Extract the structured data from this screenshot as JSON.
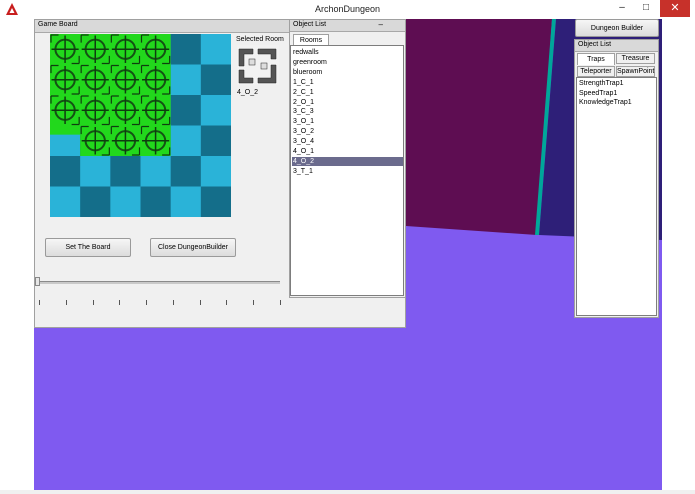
{
  "window": {
    "title": "ArchonDungeon",
    "controls": {
      "minimize": "–",
      "maximize": "□",
      "close": "✕"
    }
  },
  "colors": {
    "viewport_floor": "#7f5af0",
    "wall_dark_purple": "#5e0d52",
    "wall_navy": "#2e1f78",
    "wall_edge_teal": "#00a79a",
    "board_teal_light": "#2ab3d8",
    "board_teal_dark": "#146e8a",
    "room_green": "#22d81c",
    "selected_row": "#6b6b8d"
  },
  "game_board": {
    "title": "Game Board",
    "selected_room_label": "Selected Room",
    "selected_room_name": "4_O_2",
    "set_board_button": "Set The Board",
    "close_builder_button": "Close DungeonBuilder",
    "slider_value": 0,
    "tick_count": 10,
    "grid_rows": 6,
    "grid_cols": 6,
    "placed_room_blocks": 3
  },
  "object_list": {
    "title": "Object List",
    "collapse_glyph": "–",
    "tab": "Rooms",
    "items": [
      "redwalls",
      "greenroom",
      "blueroom",
      "1_C_1",
      "2_C_1",
      "2_O_1",
      "3_C_3",
      "3_O_1",
      "3_O_2",
      "3_O_4",
      "4_O_1",
      "4_O_2",
      "3_T_1"
    ],
    "selected": "4_O_2"
  },
  "dungeon_builder": {
    "button": "Dungeon Builder",
    "object_list_title": "Object List",
    "tabs_row1": [
      "Traps",
      "Treasure"
    ],
    "tabs_row2": [
      "Teleporter",
      "SpawnPoint"
    ],
    "active_tab": "Traps",
    "items": [
      "StrengthTrap1",
      "SpeedTrap1",
      "KnowledgeTrap1"
    ]
  }
}
